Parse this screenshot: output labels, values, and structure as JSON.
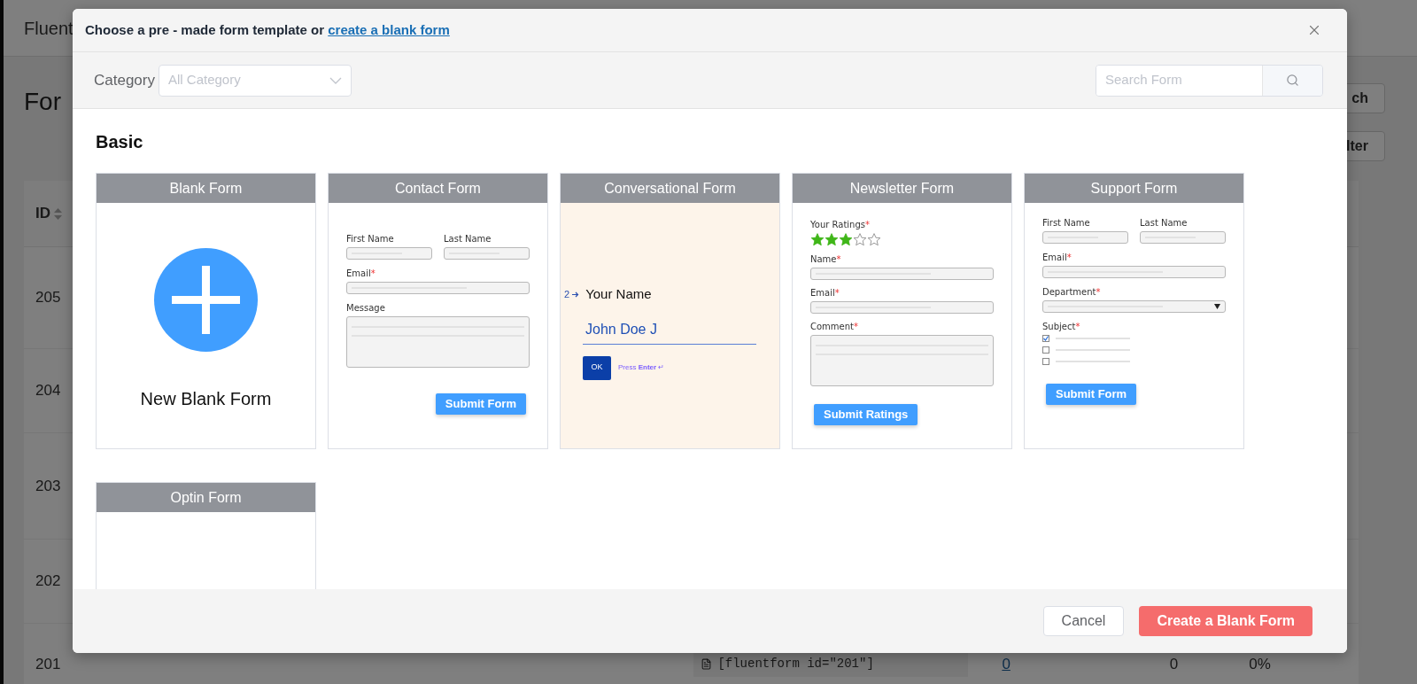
{
  "background_page": {
    "brand": "Fluent",
    "heading": "For",
    "buttons": [
      "ch",
      "lter"
    ],
    "table": {
      "columns": [
        "ID"
      ],
      "rows": [
        {
          "id": "205"
        },
        {
          "id": "204"
        },
        {
          "id": "203"
        },
        {
          "id": "202"
        },
        {
          "id": "201",
          "shortcode": "[fluentform id=\"201\"]",
          "entries": "0",
          "views": "0",
          "conversion": "0%"
        }
      ]
    }
  },
  "modal": {
    "title": "Choose a pre - made form template or",
    "title_link": "create a blank form",
    "category_label": "Category",
    "category_placeholder": "All Category",
    "search_placeholder": "Search Form",
    "section": "Basic",
    "templates": [
      {
        "kind": "blank",
        "title": "Blank Form",
        "label": "New Blank Form"
      },
      {
        "kind": "form",
        "title": "Contact Form",
        "fields": [
          {
            "kind": "half",
            "label": "First Name"
          },
          {
            "kind": "half",
            "label": "Last Name"
          },
          {
            "kind": "text",
            "label": "Email",
            "mark": "*"
          },
          {
            "kind": "textarea",
            "label": "Message"
          }
        ],
        "button": "Submit Form"
      },
      {
        "kind": "conversational",
        "title": "Conversational Form",
        "number": "2",
        "question": "Your Name",
        "answer": "John Doe J",
        "ok": "OK",
        "hint": "Press **Enter** ↵"
      },
      {
        "kind": "form",
        "title": "Newsletter Form",
        "rating_label": "Your Ratings",
        "rating_mark": "*",
        "stars": 3,
        "fields": [
          {
            "kind": "text",
            "label": "Name",
            "mark": "*"
          },
          {
            "kind": "text",
            "label": "Email",
            "mark": "*"
          },
          {
            "kind": "textarea",
            "label": "Comment",
            "mark": "*"
          }
        ],
        "button": "Submit Ratings"
      },
      {
        "kind": "form",
        "title": "Support Form",
        "fields": [
          {
            "kind": "half",
            "label": "First Name"
          },
          {
            "kind": "half",
            "label": "Last Name"
          },
          {
            "kind": "text",
            "label": "Email",
            "mark": "*"
          },
          {
            "kind": "select",
            "label": "Department",
            "mark": "*"
          },
          {
            "kind": "checkboxes",
            "label": "Subject",
            "mark": "*",
            "options": [
              {
                "checked": true
              },
              {
                "checked": false
              },
              {
                "checked": false
              }
            ]
          }
        ],
        "button": "Submit Form"
      },
      {
        "kind": "empty",
        "title": "Optin Form"
      }
    ],
    "buttons": [
      {
        "kind": "secondary",
        "label": "Cancel"
      },
      {
        "kind": "primary",
        "label": "Create a Blank Form"
      }
    ]
  }
}
